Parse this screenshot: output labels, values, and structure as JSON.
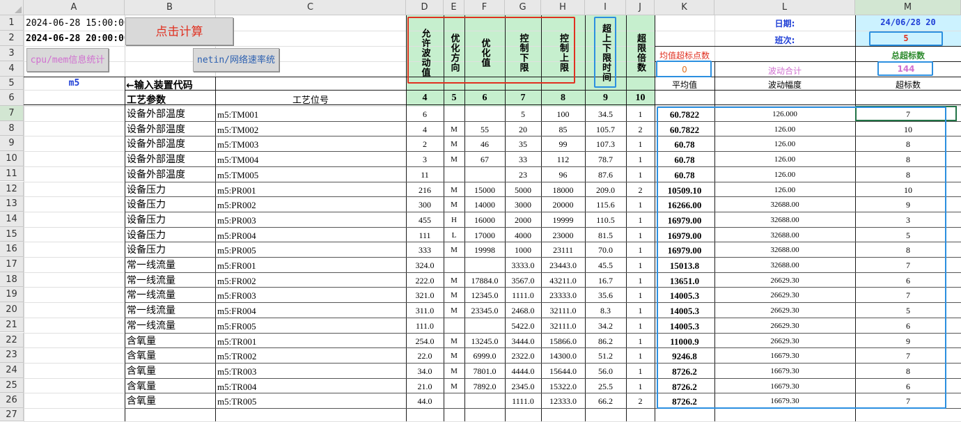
{
  "column_headers": [
    "A",
    "B",
    "C",
    "D",
    "E",
    "F",
    "G",
    "H",
    "I",
    "J",
    "K",
    "L",
    "M"
  ],
  "row_numbers": [
    "1",
    "2",
    "3",
    "4",
    "5",
    "6",
    "7",
    "8",
    "9",
    "10",
    "11",
    "12",
    "13",
    "14",
    "15",
    "16",
    "17",
    "18",
    "19",
    "20",
    "21",
    "22",
    "23",
    "24",
    "25",
    "26",
    "27"
  ],
  "start_time": "2024-06-28 15:00:00",
  "end_time": "2024-06-28 20:00:00",
  "calc_button": "点击计算",
  "cpu_button": "cpu/mem信息统计",
  "netin_button": "netin/网络速率统",
  "device_code": "m5",
  "device_code_hint": "←输入装置代码",
  "col_header_text": {
    "d": "允许波动值",
    "e": "优化方向",
    "f": "优化值",
    "g": "控制下限",
    "h": "控制上限",
    "i": "超上下限时间",
    "j": "超限倍数"
  },
  "date_label": "日期:",
  "date_value": "24/06/28 20",
  "shift_label": "班次:",
  "shift_value": "5",
  "mean_exceed_label": "均值超标点数",
  "mean_exceed_value": "0",
  "fluct_total_label": "波动合计",
  "total_exceed_label": "总超标数",
  "total_exceed_value": "144",
  "k5": "平均值",
  "l5": "波动幅度",
  "m5": "超标数",
  "b6": "工艺参数",
  "c6": "工艺位号",
  "col_numbers": [
    "4",
    "5",
    "6",
    "7",
    "8",
    "9",
    "10"
  ],
  "rows": [
    {
      "param": "设备外部温度",
      "tag": "m5:TM001",
      "d": "6",
      "e": "",
      "f": "",
      "g": "5",
      "h": "100",
      "i": "34.5",
      "j": "1",
      "k": "60.7822",
      "l": "126.000",
      "m": "7"
    },
    {
      "param": "设备外部温度",
      "tag": "m5:TM002",
      "d": "4",
      "e": "M",
      "f": "55",
      "g": "20",
      "h": "85",
      "i": "105.7",
      "j": "2",
      "k": "60.7822",
      "l": "126.00",
      "m": "10"
    },
    {
      "param": "设备外部温度",
      "tag": "m5:TM003",
      "d": "2",
      "e": "M",
      "f": "46",
      "g": "35",
      "h": "99",
      "i": "107.3",
      "j": "1",
      "k": "60.78",
      "l": "126.00",
      "m": "8"
    },
    {
      "param": "设备外部温度",
      "tag": "m5:TM004",
      "d": "3",
      "e": "M",
      "f": "67",
      "g": "33",
      "h": "112",
      "i": "78.7",
      "j": "1",
      "k": "60.78",
      "l": "126.00",
      "m": "8"
    },
    {
      "param": "设备外部温度",
      "tag": "m5:TM005",
      "d": "11",
      "e": "",
      "f": "",
      "g": "23",
      "h": "96",
      "i": "87.6",
      "j": "1",
      "k": "60.78",
      "l": "126.00",
      "m": "8"
    },
    {
      "param": "设备压力",
      "tag": "m5:PR001",
      "d": "216",
      "e": "M",
      "f": "15000",
      "g": "5000",
      "h": "18000",
      "i": "209.0",
      "j": "2",
      "k": "10509.10",
      "l": "126.00",
      "m": "10"
    },
    {
      "param": "设备压力",
      "tag": "m5:PR002",
      "d": "300",
      "e": "M",
      "f": "14000",
      "g": "3000",
      "h": "20000",
      "i": "115.6",
      "j": "1",
      "k": "16266.00",
      "l": "32688.00",
      "m": "9"
    },
    {
      "param": "设备压力",
      "tag": "m5:PR003",
      "d": "455",
      "e": "H",
      "f": "16000",
      "g": "2000",
      "h": "19999",
      "i": "110.5",
      "j": "1",
      "k": "16979.00",
      "l": "32688.00",
      "m": "3"
    },
    {
      "param": "设备压力",
      "tag": "m5:PR004",
      "d": "111",
      "e": "L",
      "f": "17000",
      "g": "4000",
      "h": "23000",
      "i": "81.5",
      "j": "1",
      "k": "16979.00",
      "l": "32688.00",
      "m": "5"
    },
    {
      "param": "设备压力",
      "tag": "m5:PR005",
      "d": "333",
      "e": "M",
      "f": "19998",
      "g": "1000",
      "h": "23111",
      "i": "70.0",
      "j": "1",
      "k": "16979.00",
      "l": "32688.00",
      "m": "8"
    },
    {
      "param": "常一线流量",
      "tag": "m5:FR001",
      "d": "324.0",
      "e": "",
      "f": "",
      "g": "3333.0",
      "h": "23443.0",
      "i": "45.5",
      "j": "1",
      "k": "15013.8",
      "l": "32688.00",
      "m": "7"
    },
    {
      "param": "常一线流量",
      "tag": "m5:FR002",
      "d": "222.0",
      "e": "M",
      "f": "17884.0",
      "g": "3567.0",
      "h": "43211.0",
      "i": "16.7",
      "j": "1",
      "k": "13651.0",
      "l": "26629.30",
      "m": "6"
    },
    {
      "param": "常一线流量",
      "tag": "m5:FR003",
      "d": "321.0",
      "e": "M",
      "f": "12345.0",
      "g": "1111.0",
      "h": "23333.0",
      "i": "35.6",
      "j": "1",
      "k": "14005.3",
      "l": "26629.30",
      "m": "7"
    },
    {
      "param": "常一线流量",
      "tag": "m5:FR004",
      "d": "311.0",
      "e": "M",
      "f": "23345.0",
      "g": "2468.0",
      "h": "32111.0",
      "i": "8.3",
      "j": "1",
      "k": "14005.3",
      "l": "26629.30",
      "m": "5"
    },
    {
      "param": "常一线流量",
      "tag": "m5:FR005",
      "d": "111.0",
      "e": "",
      "f": "",
      "g": "5422.0",
      "h": "32111.0",
      "i": "34.2",
      "j": "1",
      "k": "14005.3",
      "l": "26629.30",
      "m": "6"
    },
    {
      "param": "含氧量",
      "tag": "m5:TR001",
      "d": "254.0",
      "e": "M",
      "f": "13245.0",
      "g": "3444.0",
      "h": "15866.0",
      "i": "86.2",
      "j": "1",
      "k": "11000.9",
      "l": "26629.30",
      "m": "9"
    },
    {
      "param": "含氧量",
      "tag": "m5:TR002",
      "d": "22.0",
      "e": "M",
      "f": "6999.0",
      "g": "2322.0",
      "h": "14300.0",
      "i": "51.2",
      "j": "1",
      "k": "9246.8",
      "l": "16679.30",
      "m": "7"
    },
    {
      "param": "含氧量",
      "tag": "m5:TR003",
      "d": "34.0",
      "e": "M",
      "f": "7801.0",
      "g": "4444.0",
      "h": "15644.0",
      "i": "56.0",
      "j": "1",
      "k": "8726.2",
      "l": "16679.30",
      "m": "8"
    },
    {
      "param": "含氧量",
      "tag": "m5:TR004",
      "d": "21.0",
      "e": "M",
      "f": "7892.0",
      "g": "2345.0",
      "h": "15322.0",
      "i": "25.5",
      "j": "1",
      "k": "8726.2",
      "l": "16679.30",
      "m": "6"
    },
    {
      "param": "含氧量",
      "tag": "m5:TR005",
      "d": "44.0",
      "e": "",
      "f": "",
      "g": "1111.0",
      "h": "12333.0",
      "i": "66.2",
      "j": "2",
      "k": "8726.2",
      "l": "16679.30",
      "m": "7"
    }
  ],
  "colors": {
    "green_fill": "#c6efce",
    "cyan_fill": "#ccf2ff",
    "red_outline": "#e03020",
    "blue_outline": "#2b8fe0",
    "date_blue": "#1f3fd6"
  }
}
